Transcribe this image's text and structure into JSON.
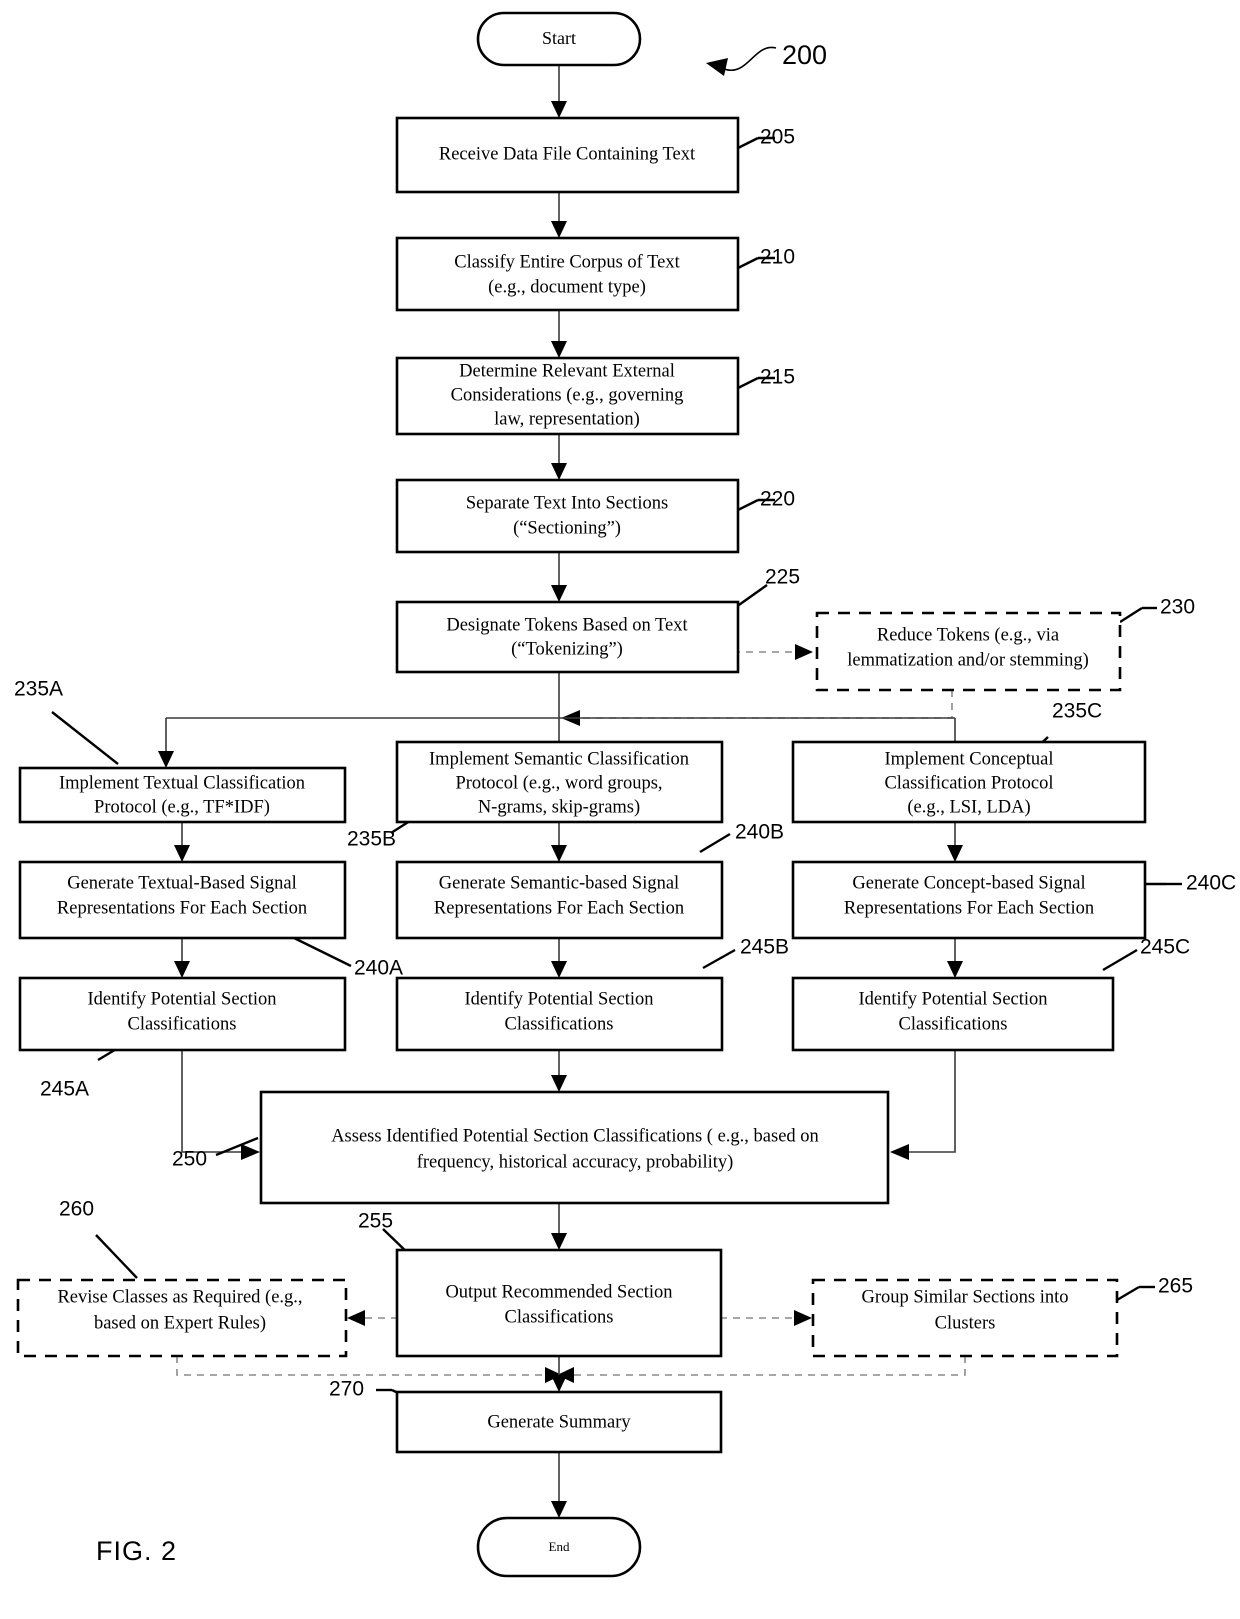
{
  "figure": {
    "caption": "FIG. 2",
    "diagram_ref": "200"
  },
  "nodes": {
    "start": {
      "label": "Start",
      "shape": "terminal"
    },
    "end": {
      "label": "End",
      "shape": "terminal"
    },
    "n205": {
      "ref": "205",
      "line1": "Receive Data File Containing Text",
      "line2": "",
      "line3": ""
    },
    "n210": {
      "ref": "210",
      "line1": "Classify Entire Corpus of Text",
      "line2": "(e.g., document type)",
      "line3": ""
    },
    "n215": {
      "ref": "215",
      "line1": "Determine Relevant External",
      "line2": "Considerations (e.g., governing",
      "line3": "law, representation)"
    },
    "n220": {
      "ref": "220",
      "line1": "Separate Text Into Sections",
      "line2": "(“Sectioning”)",
      "line3": ""
    },
    "n225": {
      "ref": "225",
      "line1": "Designate Tokens Based on Text",
      "line2": "(“Tokenizing”)",
      "line3": ""
    },
    "n230": {
      "ref": "230",
      "line1": "Reduce Tokens (e.g., via",
      "line2": "lemmatization and/or stemming)",
      "line3": "",
      "style": "dashed"
    },
    "n235A": {
      "ref": "235A",
      "line1": "Implement Textual Classification",
      "line2": "Protocol (e.g., TF*IDF)",
      "line3": ""
    },
    "n235B": {
      "ref": "235B",
      "line1": "Implement Semantic Classification",
      "line2": "Protocol (e.g., word groups,",
      "line3": "N-grams, skip-grams)"
    },
    "n235C": {
      "ref": "235C",
      "line1": "Implement Conceptual",
      "line2": "Classification Protocol",
      "line3": "(e.g.,  LSI, LDA)"
    },
    "n240A": {
      "ref": "240A",
      "line1": "Generate Textual-Based Signal",
      "line2": "Representations For Each Section",
      "line3": ""
    },
    "n240B": {
      "ref": "240B",
      "line1": "Generate Semantic-based Signal",
      "line2": "Representations For Each Section",
      "line3": ""
    },
    "n240C": {
      "ref": "240C",
      "line1": "Generate Concept-based Signal",
      "line2": "Representations For Each Section",
      "line3": ""
    },
    "n245A": {
      "ref": "245A",
      "line1": "Identify Potential Section",
      "line2": "Classifications",
      "line3": ""
    },
    "n245B": {
      "ref": "245B",
      "line1": "Identify Potential Section",
      "line2": "Classifications",
      "line3": ""
    },
    "n245C": {
      "ref": "245C",
      "line1": "Identify Potential Section",
      "line2": "Classifications",
      "line3": ""
    },
    "n250": {
      "ref": "250",
      "line1": "Assess Identified Potential Section Classifications ( e.g., based on",
      "line2": "frequency, historical accuracy, probability)",
      "line3": ""
    },
    "n255": {
      "ref": "255",
      "line1": "Output Recommended Section",
      "line2": "Classifications",
      "line3": ""
    },
    "n260": {
      "ref": "260",
      "line1": "Revise Classes as Required (e.g.,",
      "line2": "based on Expert Rules)",
      "line3": "",
      "style": "dashed"
    },
    "n265": {
      "ref": "265",
      "line1": "Group Similar Sections into",
      "line2": "Clusters",
      "line3": "",
      "style": "dashed"
    },
    "n270": {
      "ref": "270",
      "line1": "Generate Summary",
      "line2": "",
      "line3": ""
    }
  },
  "colors": {
    "stroke": "#000000",
    "fill": "#ffffff",
    "connector": "#3a3a3a",
    "connector_dashed": "#8a8a8a"
  }
}
